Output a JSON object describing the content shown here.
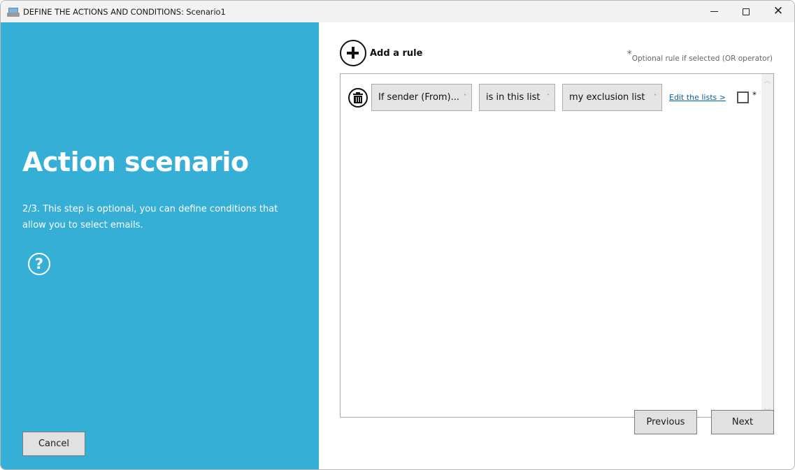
{
  "window": {
    "title": "DEFINE THE ACTIONS AND CONDITIONS: Scenario1",
    "app_icon": "mail-tray-icon",
    "controls": {
      "minimize": "minimize-icon",
      "maximize": "maximize-icon",
      "close": "close-icon"
    }
  },
  "left_panel": {
    "title": "Action scenario",
    "description": "2/3. This step is optional, you can define conditions that allow you to select emails.",
    "help_icon": "?",
    "cancel_label": "Cancel",
    "background_color": "#36afd7"
  },
  "main": {
    "add_rule_label": "Add a rule",
    "optional_note_star": "*",
    "optional_note": "Optional rule if selected (OR operator)",
    "rules": [
      {
        "field": "If sender (From)...",
        "operator": "is in this list",
        "value": "my exclusion list",
        "edit_link": "Edit the lists >",
        "or_checked": false,
        "or_marker": "*"
      }
    ],
    "previous_label": "Previous",
    "next_label": "Next"
  }
}
